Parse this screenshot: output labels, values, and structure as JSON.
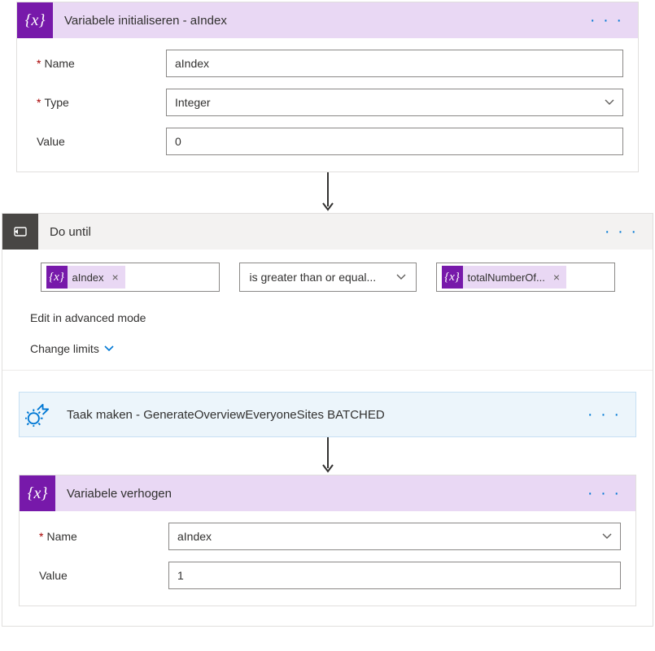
{
  "initCard": {
    "title": "Variabele initialiseren - aIndex",
    "nameLabel": "Name",
    "nameValue": "aIndex",
    "typeLabel": "Type",
    "typeValue": "Integer",
    "valueLabel": "Value",
    "valueValue": "0"
  },
  "doUntil": {
    "title": "Do until",
    "leftToken": "aIndex",
    "operator": "is greater than or equal...",
    "rightToken": "totalNumberOf...",
    "advancedModeText": "Edit in advanced mode",
    "changeLimitsText": "Change limits"
  },
  "taskCard": {
    "title": "Taak maken - GenerateOverviewEveryoneSites BATCHED"
  },
  "incCard": {
    "title": "Variabele verhogen",
    "nameLabel": "Name",
    "nameValue": "aIndex",
    "valueLabel": "Value",
    "valueValue": "1"
  },
  "ui": {
    "moreDots": "· · ·",
    "removeX": "×",
    "varGlyph": "{x}"
  }
}
